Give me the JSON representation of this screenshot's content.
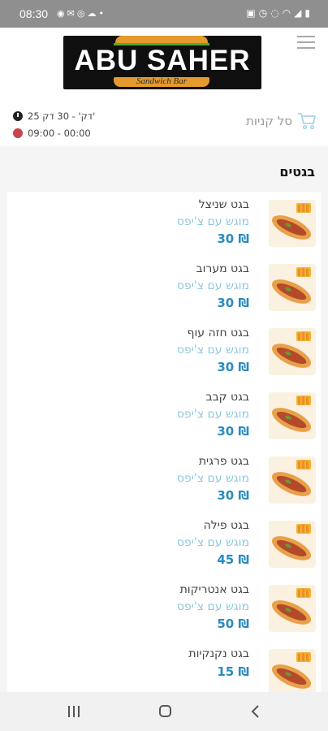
{
  "status_bar": {
    "time": "08:30",
    "left_icons": [
      "whatsapp-icon",
      "mail-icon",
      "instagram-icon",
      "cloud-icon",
      "dot-icon"
    ],
    "right_icons": [
      "lock-icon",
      "alarm-icon",
      "mute-icon",
      "wifi-icon",
      "signal-icon",
      "battery-icon"
    ]
  },
  "header": {
    "logo_title": "ABU SAHER",
    "logo_subtitle": "Sandwich Bar",
    "cart_label": "סל קניות",
    "delivery_time": "25 דק' - 30 דק'",
    "opening_hours": "09:00 - 00:00"
  },
  "colors": {
    "accent_blue": "#2a8bbf",
    "desc_blue": "#8fc7e0",
    "closed_red": "#c8434a",
    "logo_orange": "#e59a2d",
    "logo_green": "#55a832"
  },
  "menu": {
    "section_title": "בגטים",
    "items": [
      {
        "name": "בגט שניצל",
        "desc": "מוגש עם צ'יפס",
        "price": "30 ₪"
      },
      {
        "name": "בגט מערוב",
        "desc": "מוגש עם צ'יפס",
        "price": "30 ₪"
      },
      {
        "name": "בגט חזה עוף",
        "desc": "מוגש עם צ'יפס",
        "price": "30 ₪"
      },
      {
        "name": "בגט קבב",
        "desc": "מוגש עם צ'יפס",
        "price": "30 ₪"
      },
      {
        "name": "בגט פרגית",
        "desc": "מוגש עם צ'יפס",
        "price": "30 ₪"
      },
      {
        "name": "בגט פילה",
        "desc": "מוגש עם צ'יפס",
        "price": "45 ₪"
      },
      {
        "name": "בגט אנטריקות",
        "desc": "מוגש עם צ'יפס",
        "price": "50 ₪"
      },
      {
        "name": "בגט נקנקיות",
        "desc": "",
        "price": "15 ₪"
      }
    ]
  },
  "nav_bar": {
    "icons": [
      "recents-icon",
      "home-icon",
      "back-icon"
    ]
  }
}
